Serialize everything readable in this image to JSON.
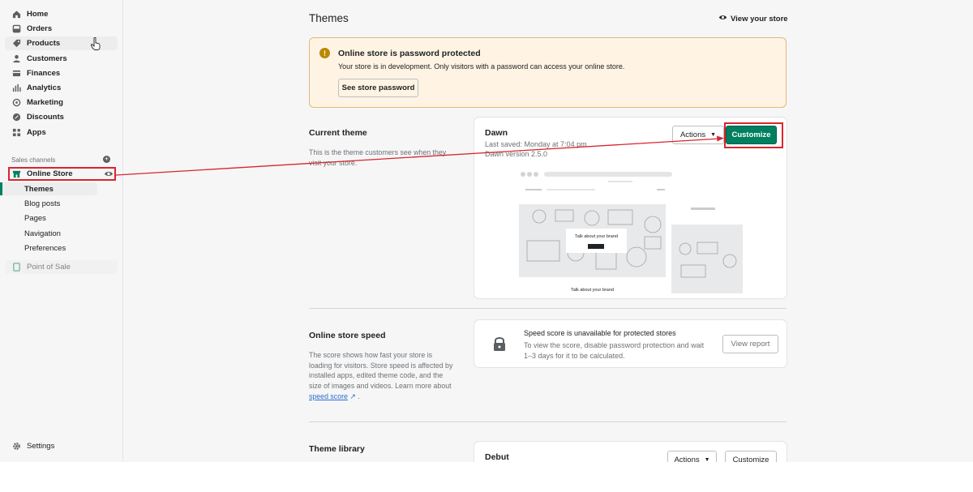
{
  "sidebar": {
    "items": [
      {
        "label": "Home",
        "icon": "home-icon"
      },
      {
        "label": "Orders",
        "icon": "orders-icon"
      },
      {
        "label": "Products",
        "icon": "tag-icon"
      },
      {
        "label": "Customers",
        "icon": "person-icon"
      },
      {
        "label": "Finances",
        "icon": "finances-icon"
      },
      {
        "label": "Analytics",
        "icon": "analytics-icon"
      },
      {
        "label": "Marketing",
        "icon": "marketing-icon"
      },
      {
        "label": "Discounts",
        "icon": "discount-icon"
      },
      {
        "label": "Apps",
        "icon": "apps-icon"
      }
    ],
    "sales_channels_label": "Sales channels",
    "online_store": "Online Store",
    "subitems": [
      "Themes",
      "Blog posts",
      "Pages",
      "Navigation",
      "Preferences"
    ],
    "point_of_sale": "Point of Sale",
    "settings": "Settings"
  },
  "header": {
    "title": "Themes",
    "view_store": "View your store"
  },
  "banner": {
    "title": "Online store is password protected",
    "desc": "Your store is in development. Only visitors with a password can access your online store.",
    "button": "See store password"
  },
  "current_theme": {
    "section_title": "Current theme",
    "section_desc": "This is the theme customers see when they visit your store.",
    "name": "Dawn",
    "last_saved": "Last saved: Monday at 7:04 pm",
    "version": "Dawn version 2.5.0",
    "actions": "Actions",
    "customize": "Customize",
    "preview_brand": "Talk about your brand",
    "preview_footer": "Talk about your brand"
  },
  "speed": {
    "section_title": "Online store speed",
    "section_desc": "The score shows how fast your store is loading for visitors. Store speed is affected by installed apps, edited theme code, and the size of images and videos. Learn more about",
    "link": "speed score",
    "card_title": "Speed score is unavailable for protected stores",
    "card_desc": "To view the score, disable password protection and wait 1–3 days for it to be calculated.",
    "button": "View report"
  },
  "library": {
    "section_title": "Theme library",
    "theme_name": "Debut",
    "actions": "Actions",
    "customize": "Customize"
  },
  "colors": {
    "primary": "#008060",
    "annotation": "#d9252e",
    "banner_bg": "#fff4e4"
  }
}
